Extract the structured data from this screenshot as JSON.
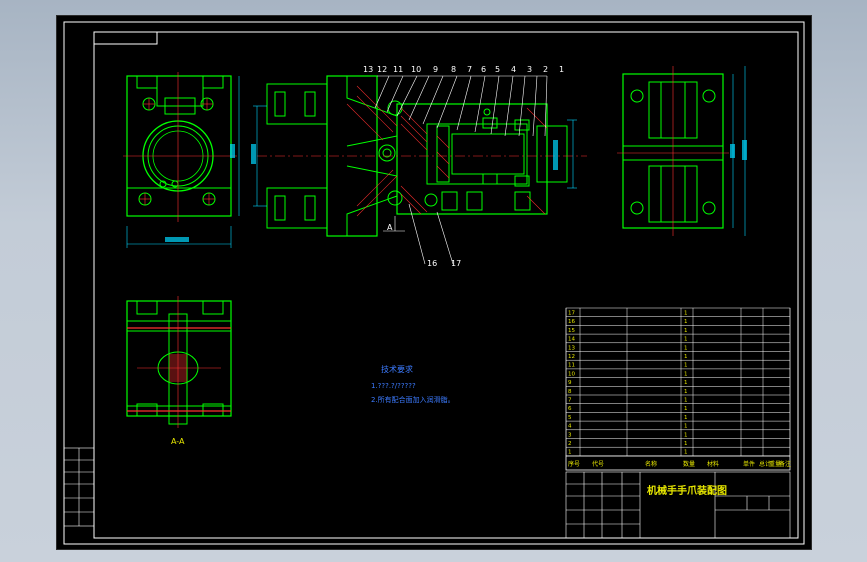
{
  "drawing": {
    "title": "机械手手爪装配图",
    "section_label": "A-A",
    "section_mark": "A",
    "balloons": [
      "13",
      "12",
      "11",
      "10",
      "9",
      "8",
      "7",
      "6",
      "5",
      "4",
      "3",
      "2",
      "1"
    ],
    "balloons_lower": [
      "16",
      "17"
    ],
    "tech_requirements": {
      "heading": "技术要求",
      "line1": "1.???.?/?????",
      "line2": "2.所有配合面加入润滑脂。"
    },
    "bom_header": [
      "序号",
      "代号",
      "名称",
      "数量",
      "材料",
      "单件",
      "总计",
      "重量",
      "备注"
    ],
    "bom_rows": [
      {
        "no": "17",
        "name": "",
        "qty": "1",
        "material": "",
        "note": ""
      },
      {
        "no": "16",
        "name": "",
        "qty": "1",
        "material": "",
        "note": ""
      },
      {
        "no": "15",
        "name": "",
        "qty": "1",
        "material": "",
        "note": ""
      },
      {
        "no": "14",
        "name": "",
        "qty": "1",
        "material": "",
        "note": ""
      },
      {
        "no": "13",
        "name": "",
        "qty": "1",
        "material": "",
        "note": ""
      },
      {
        "no": "12",
        "name": "",
        "qty": "1",
        "material": "",
        "note": ""
      },
      {
        "no": "11",
        "name": "",
        "qty": "1",
        "material": "",
        "note": ""
      },
      {
        "no": "10",
        "name": "",
        "qty": "1",
        "material": "",
        "note": ""
      },
      {
        "no": "9",
        "name": "",
        "qty": "1",
        "material": "",
        "note": ""
      },
      {
        "no": "8",
        "name": "",
        "qty": "1",
        "material": "",
        "note": ""
      },
      {
        "no": "7",
        "name": "",
        "qty": "1",
        "material": "",
        "note": ""
      },
      {
        "no": "6",
        "name": "",
        "qty": "1",
        "material": "",
        "note": ""
      },
      {
        "no": "5",
        "name": "",
        "qty": "1",
        "material": "",
        "note": ""
      },
      {
        "no": "4",
        "name": "",
        "qty": "1",
        "material": "",
        "note": ""
      },
      {
        "no": "3",
        "name": "",
        "qty": "1",
        "material": "",
        "note": ""
      },
      {
        "no": "2",
        "name": "",
        "qty": "1",
        "material": "",
        "note": ""
      },
      {
        "no": "1",
        "name": "",
        "qty": "1",
        "material": "",
        "note": ""
      }
    ]
  },
  "colors": {
    "part_outline": "#00ff00",
    "frame": "#ffffff",
    "centerline": "#ff3030",
    "dimension": "#00d8ff",
    "hatch": "#ff3030",
    "text_yellow": "#e8e800",
    "balloon_leader": "#ffffff"
  }
}
